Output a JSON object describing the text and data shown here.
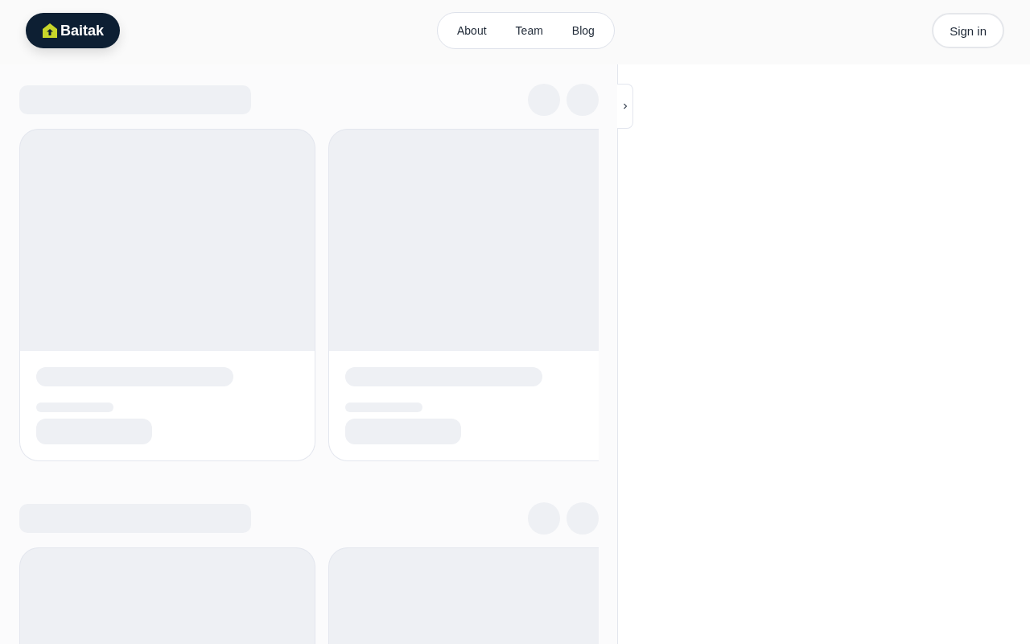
{
  "logo": {
    "text": "Baitak"
  },
  "nav": [
    {
      "label": "About"
    },
    {
      "label": "Team"
    },
    {
      "label": "Blog"
    }
  ],
  "sign_in": {
    "label": "Sign in"
  },
  "panel_toggle": {
    "expanded": false
  },
  "sections": [
    {
      "kind": "skeleton",
      "cards": [
        {
          "kind": "skeleton"
        },
        {
          "kind": "skeleton"
        }
      ]
    },
    {
      "kind": "skeleton",
      "cards": [
        {
          "kind": "skeleton_image_only"
        },
        {
          "kind": "skeleton_image_only"
        }
      ]
    }
  ]
}
